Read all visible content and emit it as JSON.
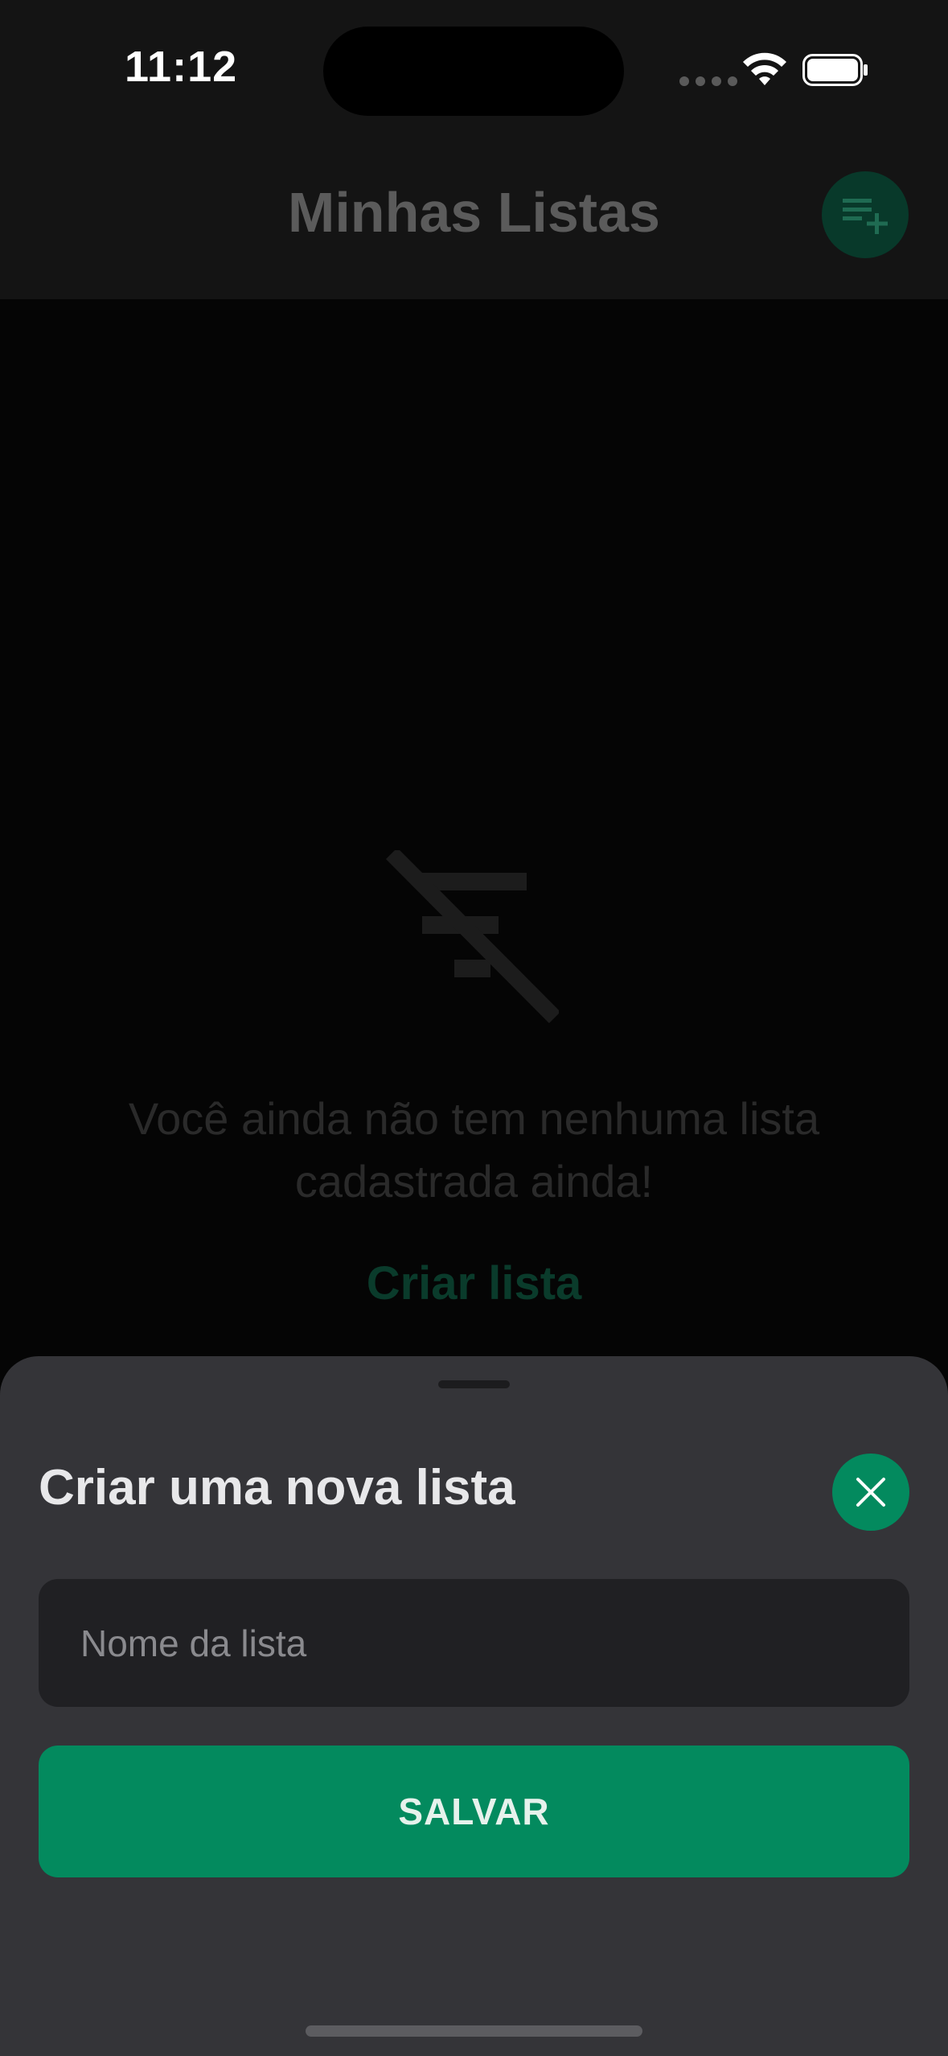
{
  "status_bar": {
    "time": "11:12",
    "icons": [
      "signal-dots-icon",
      "wifi-icon",
      "battery-icon"
    ]
  },
  "header": {
    "title": "Minhas Listas",
    "add_button_icon": "playlist-add-icon"
  },
  "empty_state": {
    "icon": "filter-off-icon",
    "message": "Você ainda não tem nenhuma lista cadastrada ainda!",
    "create_link": "Criar lista"
  },
  "sheet": {
    "title": "Criar uma nova lista",
    "close_icon": "close-icon",
    "input": {
      "placeholder": "Nome da lista",
      "value": ""
    },
    "save_label": "SALVAR"
  },
  "colors": {
    "accent": "#038a5e",
    "accent_dimmed": "#0a3b2b",
    "sheet_background": "#343438",
    "input_background": "#202023",
    "backdrop": "#050505"
  }
}
